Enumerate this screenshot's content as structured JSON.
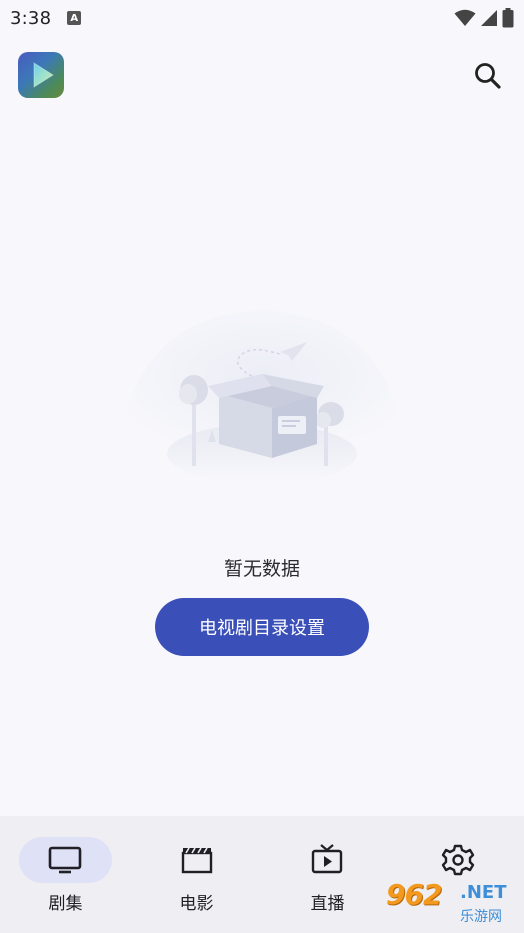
{
  "status_bar": {
    "time": "3:38",
    "notification_icon_letter": "A",
    "icons": [
      "wifi-icon",
      "cellular-signal-icon",
      "battery-icon"
    ]
  },
  "app_bar": {
    "logo_icon": "play-logo-icon",
    "search_icon": "search-icon"
  },
  "empty_state": {
    "illustration": "empty-box-illustration",
    "message": "暂无数据",
    "button_label": "电视剧目录设置"
  },
  "colors": {
    "accent": "#3a4fb8",
    "nav_active_pill": "#dfe1f7",
    "background": "#f8f8fc",
    "nav_background": "#eeeef3"
  },
  "bottom_nav": {
    "items": [
      {
        "label": "剧集",
        "icon": "tv-icon",
        "active": true
      },
      {
        "label": "电影",
        "icon": "movie-clapper-icon",
        "active": false
      },
      {
        "label": "直播",
        "icon": "live-tv-icon",
        "active": false
      },
      {
        "label": "",
        "icon": "settings-gear-icon",
        "active": false
      }
    ]
  },
  "watermark": {
    "main": "962",
    "net": ".NET",
    "sub": "乐游网"
  }
}
